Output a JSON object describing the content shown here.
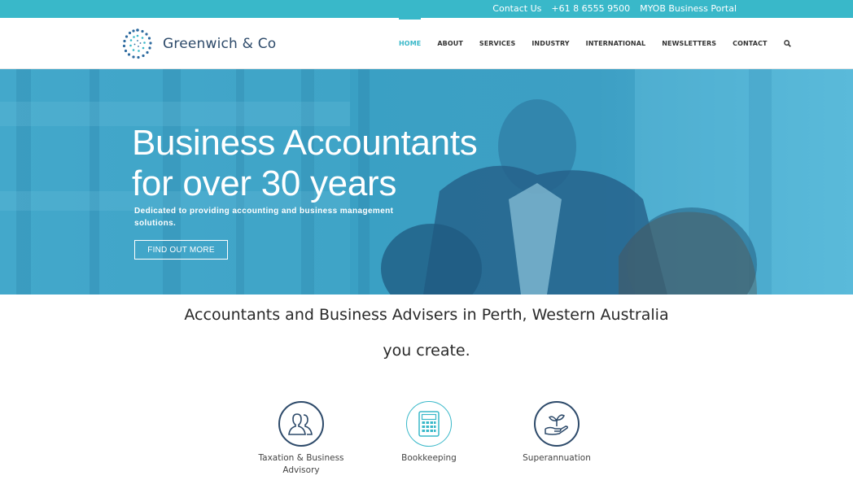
{
  "colors": {
    "accent": "#39b8c9",
    "navy": "#2d4a6a",
    "hero": "#3aa0c4"
  },
  "topbar": {
    "contact": "Contact Us",
    "phone": "+61 8 6555 9500",
    "portal": "MYOB Business Portal"
  },
  "header": {
    "logo_text": "Greenwich & Co",
    "nav": {
      "home": "HOME",
      "about": "ABOUT",
      "services": "SERVICES",
      "industry": "INDUSTRY",
      "international": "INTERNATIONAL",
      "newsletters": "NEWSLETTERS",
      "contact": "CONTACT"
    },
    "search_icon": "search-icon"
  },
  "hero": {
    "title_line1": "Business Accountants",
    "title_line2": "for over 30 years",
    "subtitle": "Dedicated to providing accounting and business management solutions.",
    "button": "FIND OUT MORE"
  },
  "intro": {
    "title": "Accountants and Business Advisers in Perth, Western Australia",
    "subtitle": "you create."
  },
  "services": [
    {
      "label": "Taxation & Business Advisory",
      "icon": "people-icon"
    },
    {
      "label": "Bookkeeping",
      "icon": "calculator-icon"
    },
    {
      "label": "Superannuation",
      "icon": "plant-in-hand-icon"
    }
  ]
}
